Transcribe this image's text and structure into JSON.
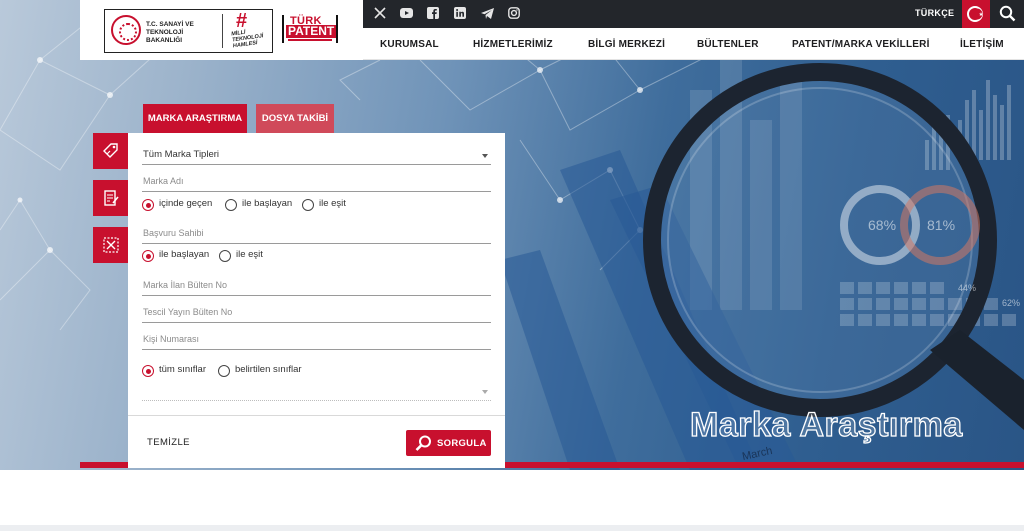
{
  "header": {
    "ministry_name": "T.C. SANAYİ VE TEKNOLOJİ BAKANLIĞI",
    "milli_teknoloji": "MİLLİ TEKNOLOJİ HAMLESİ",
    "turk_patent_line1": "TÜRK",
    "turk_patent_line2": "PATENT",
    "social_icons": [
      "x-icon",
      "youtube-icon",
      "facebook-icon",
      "linkedin-icon",
      "telegram-icon",
      "instagram-icon"
    ],
    "language": "TÜRKÇE",
    "nav": [
      "KURUMSAL",
      "HİZMETLERİMİZ",
      "BİLGİ MERKEZİ",
      "BÜLTENLER",
      "PATENT/MARKA VEKİLLERİ",
      "İLETİŞİM"
    ]
  },
  "tabs": [
    "MARKA ARAŞTIRMA",
    "DOSYA TAKİBİ"
  ],
  "form": {
    "type_select": "Tüm Marka Tipleri",
    "mark_name_placeholder": "Marka Adı",
    "name_options": [
      "içinde geçen",
      "ile başlayan",
      "ile eşit"
    ],
    "name_selected": 0,
    "applicant_placeholder": "Başvuru Sahibi",
    "applicant_options": [
      "ile başlayan",
      "ile eşit"
    ],
    "applicant_selected": 0,
    "bulletin_placeholder": "Marka İlan Bülten No",
    "registry_placeholder": "Tescil Yayın Bülten No",
    "person_placeholder": "Kişi Numarası",
    "class_options": [
      "tüm sınıflar",
      "belirtilen sınıflar"
    ],
    "class_selected": 0,
    "clear_label": "TEMİZLE",
    "query_label": "SORGULA"
  },
  "hero": {
    "title": "Marka Araştırma",
    "stats": [
      "68%",
      "81%",
      "44%",
      "62%"
    ],
    "month_label": "March"
  },
  "colors": {
    "brand_red": "#c8102e",
    "topbar": "#23262b"
  }
}
